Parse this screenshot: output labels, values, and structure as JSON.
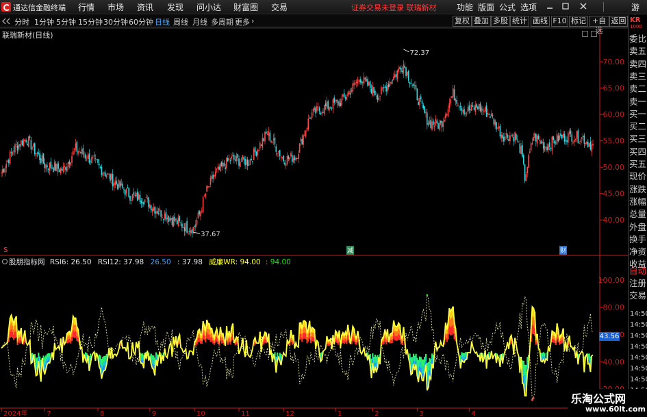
{
  "menubar": {
    "app_title": "通达信金融终端",
    "menus": [
      "行情",
      "市场",
      "资讯",
      "发现",
      "问小达",
      "财富圈",
      "交易"
    ],
    "status": "证券交易未登录  联瑞新材",
    "right_menus": [
      "功能",
      "版面",
      "公式",
      "选项"
    ],
    "guest": "游客"
  },
  "toolbar": {
    "periods": [
      "分时",
      "1分钟",
      "5分钟",
      "15分钟",
      "30分钟",
      "60分钟",
      "日线",
      "周线",
      "月线",
      "多周期",
      "更多"
    ],
    "more_arrow": "›",
    "active_period": "日线",
    "right_buttons": [
      "复权",
      "叠加",
      "多股",
      "统计",
      "画线",
      "F10",
      "标记",
      "+自选",
      "返回"
    ]
  },
  "main_panel": {
    "title": "联瑞新材(日线)",
    "marker_s": "S",
    "marker_jian": "减",
    "marker_cai": "财"
  },
  "indicator_panel": {
    "title": "股朋指标网",
    "rsi6_label": "RSI6: 26.50",
    "rsi12_label": "RSI12: 37.98",
    "v1": "26.50",
    "v2": ": 37.98",
    "wr_label": "威廉WR: 94.00",
    "v3": ": 94.00",
    "cursor_value": "43.56"
  },
  "sidebar": {
    "badge": "KR",
    "badge_sub": "1000",
    "items": [
      "委比",
      "卖五",
      "卖四",
      "卖三",
      "卖二",
      "卖一",
      "买一",
      "买二",
      "买三",
      "买四",
      "买五",
      "现价",
      "涨跌",
      "涨幅",
      "总量",
      "外盘",
      "换手",
      "净资",
      "收益"
    ],
    "items2": [
      "自动",
      "注册",
      "交易"
    ],
    "times": [
      "14:50",
      "14:50",
      "14:50",
      "14:50",
      "14:50",
      "14:50",
      "14:50",
      "14:50"
    ]
  },
  "watermark": {
    "line1": "乐淘公式网",
    "line2": "www.60lt.com"
  },
  "colors": {
    "up": "#ff4a4a",
    "down": "#34d8e0",
    "axis_red": "#c81e1e",
    "active_blue": "#4fa8ff",
    "rsi_yellow": "#ffff40",
    "wr_green": "#22e022",
    "rsi6_blue": "#3aa0ff"
  },
  "chart_data": [
    {
      "type": "candlestick",
      "title": "联瑞新材(日线)",
      "ylim": [
        36,
        76
      ],
      "yticks": [
        40.0,
        45.0,
        50.0,
        55.0,
        60.0,
        65.0,
        70.0
      ],
      "x_tick_labels": [
        "2024年",
        "7",
        "8",
        "9",
        "10",
        "11",
        "12",
        "1",
        "2",
        "3",
        "4"
      ],
      "annotations": [
        {
          "text": "72.37",
          "value": 72.37,
          "type": "max"
        },
        {
          "text": "37.67",
          "value": 37.67,
          "type": "min"
        }
      ],
      "close_anchors": [
        [
          0,
          49.0
        ],
        [
          10,
          53.5
        ],
        [
          20,
          55.5
        ],
        [
          35,
          50.5
        ],
        [
          50,
          49.5
        ],
        [
          60,
          53.5
        ],
        [
          75,
          51.0
        ],
        [
          90,
          47.5
        ],
        [
          105,
          44.5
        ],
        [
          115,
          44.0
        ],
        [
          125,
          42.0
        ],
        [
          135,
          40.5
        ],
        [
          150,
          38.5
        ],
        [
          155,
          38.4
        ],
        [
          160,
          41.0
        ],
        [
          165,
          45.0
        ],
        [
          172,
          48.5
        ],
        [
          185,
          51.5
        ],
        [
          200,
          51.0
        ],
        [
          215,
          56.5
        ],
        [
          228,
          51.5
        ],
        [
          238,
          52.0
        ],
        [
          250,
          60.0
        ],
        [
          263,
          61.5
        ],
        [
          275,
          62.5
        ],
        [
          290,
          67.0
        ],
        [
          305,
          63.5
        ],
        [
          318,
          67.5
        ],
        [
          325,
          69.5
        ],
        [
          335,
          64.0
        ],
        [
          345,
          58.5
        ],
        [
          355,
          58.0
        ],
        [
          365,
          64.0
        ],
        [
          375,
          60.5
        ],
        [
          385,
          61.5
        ],
        [
          395,
          60.0
        ],
        [
          405,
          56.0
        ],
        [
          415,
          56.0
        ],
        [
          420,
          53.0
        ],
        [
          423,
          48.0
        ],
        [
          430,
          56.0
        ],
        [
          440,
          54.0
        ],
        [
          450,
          55.5
        ],
        [
          460,
          56.0
        ],
        [
          470,
          55.5
        ],
        [
          478,
          54.0
        ]
      ]
    },
    {
      "type": "line",
      "title": "股朋指标网",
      "ylim": [
        10,
        110
      ],
      "yticks": [
        20.0,
        40.0,
        60.0,
        80.0,
        100.0
      ],
      "series": [
        {
          "name": "RSI6",
          "last": 26.5
        },
        {
          "name": "RSI12",
          "last": 37.98
        },
        {
          "name": "威廉WR",
          "last": 94.0
        }
      ]
    }
  ]
}
